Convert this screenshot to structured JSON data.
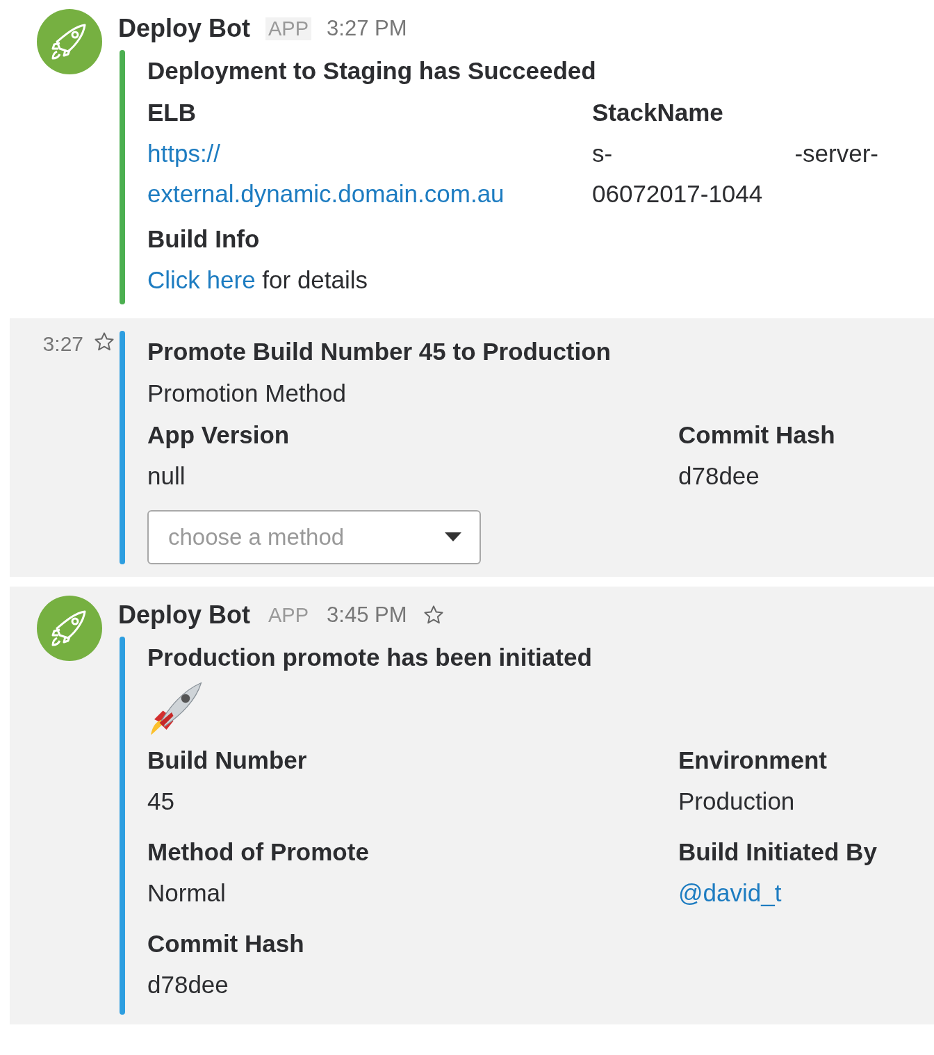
{
  "messages": [
    {
      "kind": "full",
      "highlighted": false,
      "author": "Deploy Bot",
      "badge": "APP",
      "time": "3:27 PM",
      "star": false,
      "attachment": {
        "color": "#4caf50",
        "title": "Deployment to Staging has Succeeded",
        "emoji_line": false,
        "fields": [
          {
            "title": "ELB",
            "short": true,
            "lines": [
              {
                "gap": false,
                "segments": [
                  {
                    "text": "https://",
                    "link": true
                  }
                ]
              },
              {
                "gap": false,
                "segments": [
                  {
                    "text": "external.dynamic.domain.com.au",
                    "link": true
                  }
                ]
              }
            ]
          },
          {
            "title": "StackName",
            "short": true,
            "lines": [
              {
                "gap": true,
                "segments": [
                  {
                    "text": "s-",
                    "link": false
                  },
                  {
                    "text": "-server-",
                    "link": false
                  }
                ]
              },
              {
                "gap": false,
                "segments": [
                  {
                    "text": "06072017-1044",
                    "link": false
                  }
                ]
              }
            ]
          },
          {
            "title": "Build Info",
            "short": false,
            "lines": [
              {
                "gap": false,
                "segments": [
                  {
                    "text": "Click here",
                    "link": true
                  },
                  {
                    "text": " for details",
                    "link": false
                  }
                ]
              }
            ]
          }
        ]
      }
    },
    {
      "kind": "continuation",
      "highlighted": true,
      "time": "3:27",
      "star": true,
      "attachment": {
        "color": "#2d9ee0",
        "title": "Promote Build Number 45 to Production",
        "text": "Promotion Method",
        "emoji_line": false,
        "fields": [
          {
            "title": "App Version",
            "short": true,
            "lines": [
              {
                "gap": false,
                "segments": [
                  {
                    "text": "null",
                    "link": false
                  }
                ]
              }
            ]
          },
          {
            "title": "Commit Hash",
            "short": true,
            "lines": [
              {
                "gap": false,
                "segments": [
                  {
                    "text": "d78dee",
                    "link": false
                  }
                ]
              }
            ]
          }
        ],
        "select": {
          "placeholder": "choose a method"
        }
      }
    },
    {
      "kind": "full",
      "highlighted": true,
      "author": "Deploy Bot",
      "badge": "APP",
      "time": "3:45 PM",
      "star": true,
      "attachment": {
        "color": "#2d9ee0",
        "title": "Production promote has been initiated",
        "emoji_line": true,
        "fields": [
          {
            "title": "Build Number",
            "short": true,
            "lines": [
              {
                "gap": false,
                "segments": [
                  {
                    "text": "45",
                    "link": false
                  }
                ]
              }
            ]
          },
          {
            "title": "Environment",
            "short": true,
            "lines": [
              {
                "gap": false,
                "segments": [
                  {
                    "text": "Production",
                    "link": false
                  }
                ]
              }
            ]
          },
          {
            "title": "Method of Promote",
            "short": true,
            "lines": [
              {
                "gap": false,
                "segments": [
                  {
                    "text": "Normal",
                    "link": false
                  }
                ]
              }
            ]
          },
          {
            "title": "Build Initiated By",
            "short": true,
            "lines": [
              {
                "gap": false,
                "segments": [
                  {
                    "text": "@david_t",
                    "link": true
                  }
                ]
              }
            ]
          },
          {
            "title": "Commit Hash",
            "short": true,
            "lines": [
              {
                "gap": false,
                "segments": [
                  {
                    "text": "d78dee",
                    "link": false
                  }
                ]
              }
            ]
          }
        ]
      }
    }
  ]
}
